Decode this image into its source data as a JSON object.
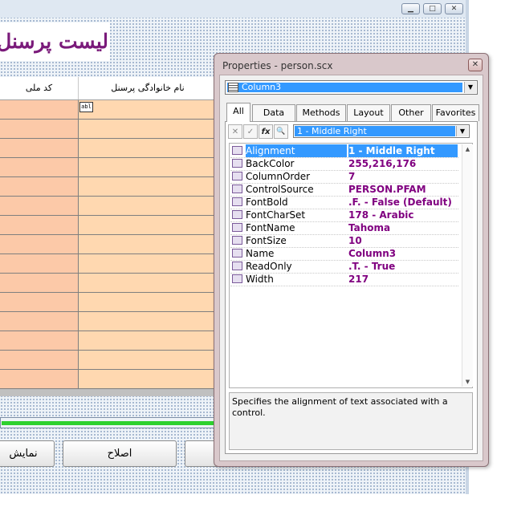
{
  "form": {
    "title_text": "لیست پرسنل",
    "grid": {
      "columns": [
        "کد ملی",
        "نام خانوادگی پرسنل"
      ],
      "cell_icon_text": "abl",
      "row_count": 15
    },
    "progress": {
      "value_percent": 100
    },
    "buttons": [
      {
        "label": "نمایش"
      },
      {
        "label": "اصلاح"
      },
      {
        "label": ""
      }
    ],
    "colors": {
      "title": "#7a1a7a",
      "cell_col1": "#fcc9a8",
      "cell_col2": "#ffd8b0",
      "progress": "#2ed12e"
    }
  },
  "window_controls": {
    "minimize": "minimize-icon",
    "maximize": "maximize-icon",
    "close": "close-icon"
  },
  "properties": {
    "window_title": "Properties - person.scx",
    "close_glyph": "✕",
    "object_selector": {
      "value": "Column3",
      "icon": "table-icon"
    },
    "tabs": [
      {
        "label": "All",
        "active": true
      },
      {
        "label": "Data"
      },
      {
        "label": "Methods"
      },
      {
        "label": "Layout"
      },
      {
        "label": "Other"
      },
      {
        "label": "Favorites"
      }
    ],
    "toolbar": {
      "cancel_glyph": "✕",
      "accept_glyph": "✓",
      "function_glyph": "fx",
      "zoom_glyph": "🔍",
      "value_combo": "1 - Middle Right"
    },
    "rows": [
      {
        "name": "Alignment",
        "value": "1 - Middle Right",
        "selected": true
      },
      {
        "name": "BackColor",
        "value": "255,216,176"
      },
      {
        "name": "ColumnOrder",
        "value": "7"
      },
      {
        "name": "ControlSource",
        "value": "PERSON.PFAM"
      },
      {
        "name": "FontBold",
        "value": ".F. - False (Default)"
      },
      {
        "name": "FontCharSet",
        "value": "178 - Arabic"
      },
      {
        "name": "FontName",
        "value": "Tahoma"
      },
      {
        "name": "FontSize",
        "value": "10"
      },
      {
        "name": "Name",
        "value": "Column3"
      },
      {
        "name": "ReadOnly",
        "value": ".T. - True"
      },
      {
        "name": "Width",
        "value": "217"
      }
    ],
    "description": "Specifies the alignment of text associated with a control."
  }
}
